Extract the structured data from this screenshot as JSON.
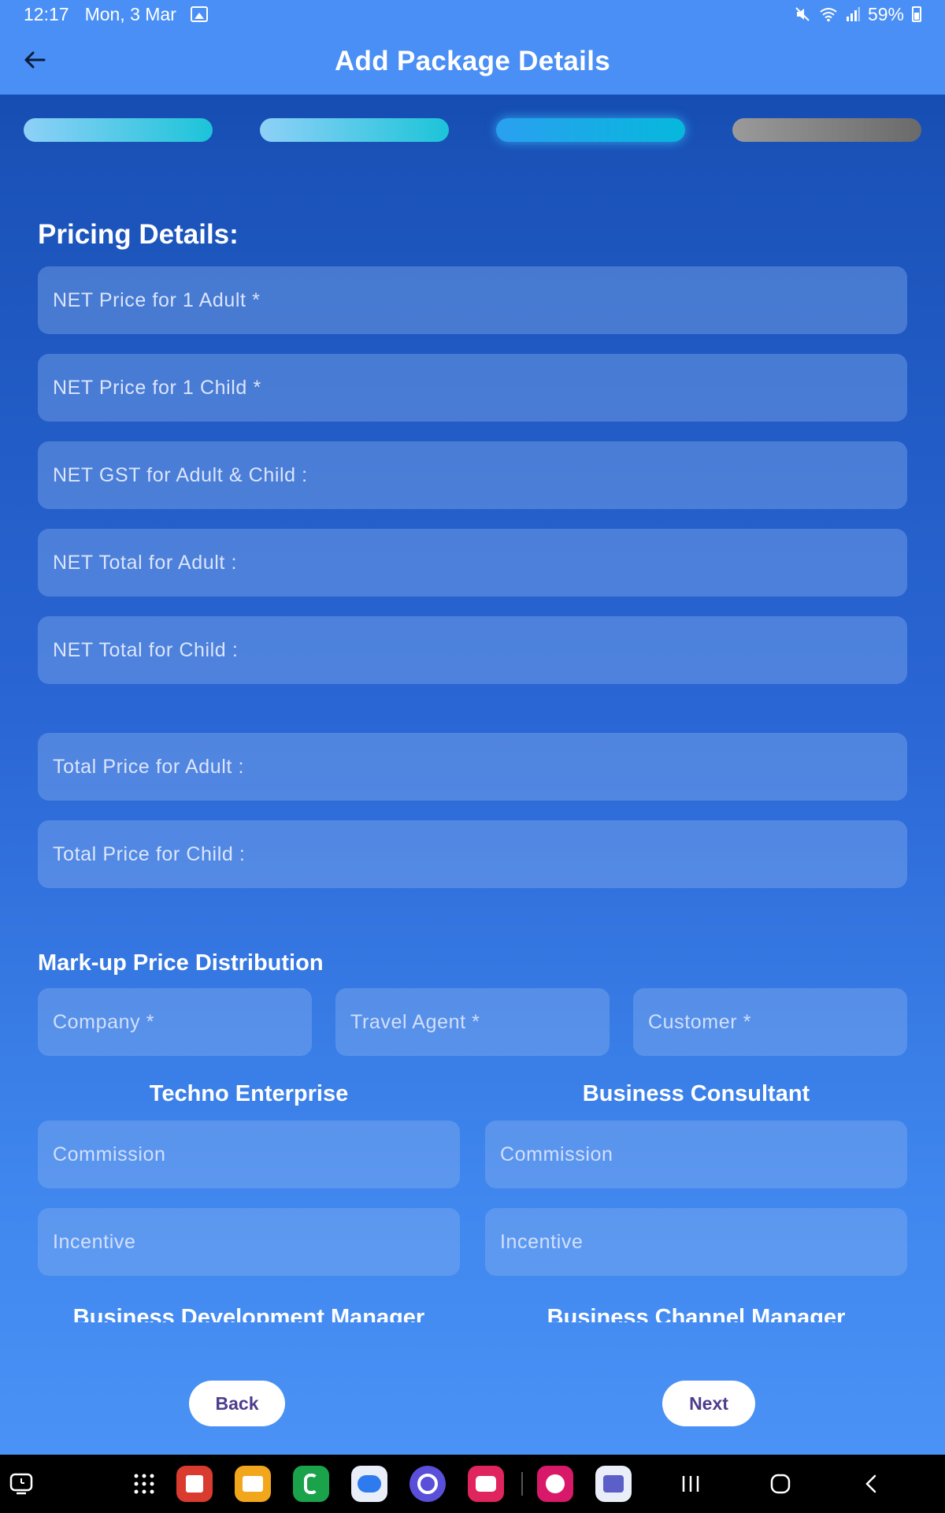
{
  "status_bar": {
    "time": "12:17",
    "date": "Mon, 3 Mar",
    "battery": "59%"
  },
  "app_bar": {
    "title": "Add Package Details"
  },
  "steps": [
    {
      "state": "done"
    },
    {
      "state": "done"
    },
    {
      "state": "active"
    },
    {
      "state": "pending"
    }
  ],
  "pricing": {
    "heading": "Pricing Details:",
    "fields": [
      {
        "placeholder": "NET Price for 1 Adult *"
      },
      {
        "placeholder": "NET Price for 1 Child *"
      },
      {
        "placeholder": "NET GST for Adult & Child :"
      },
      {
        "placeholder": "NET Total for Adult :"
      },
      {
        "placeholder": "NET Total for Child :"
      },
      {
        "placeholder": "Total Price for Adult :"
      },
      {
        "placeholder": "Total Price for Child :"
      }
    ]
  },
  "markup": {
    "heading": "Mark-up Price Distribution",
    "fields": [
      {
        "placeholder": "Company *"
      },
      {
        "placeholder": "Travel Agent *"
      },
      {
        "placeholder": "Customer *"
      }
    ]
  },
  "roles": [
    {
      "title": "Techno Enterprise",
      "commission": "Commission",
      "incentive": "Incentive"
    },
    {
      "title": "Business Consultant",
      "commission": "Commission",
      "incentive": "Incentive"
    },
    {
      "title": "Business Development Manager"
    },
    {
      "title": "Business Channel Manager"
    }
  ],
  "buttons": {
    "back": "Back",
    "next": "Next"
  }
}
